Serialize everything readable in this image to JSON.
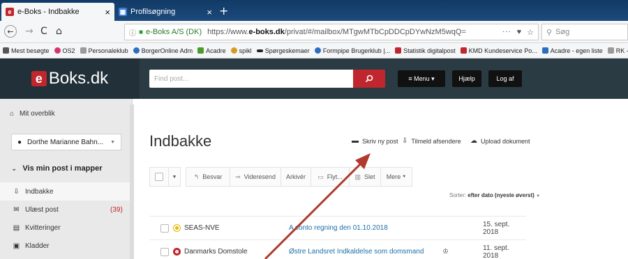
{
  "browser": {
    "tabs": [
      {
        "label": "e-Boks - Indbakke",
        "close": "×"
      },
      {
        "label": "Profilsøgning",
        "close": "×"
      }
    ],
    "new_tab": "+",
    "nav": {
      "back": "←",
      "forward": "→",
      "reload": "C",
      "home": "⌂"
    },
    "url": {
      "site": "e-Boks A/S (DK)",
      "prefix": "https://www.",
      "domain": "e-boks.dk",
      "path": "/privat/#/mailbox/MTgwMTbCpDDCpDYwNzM5wqQ=",
      "more": "···",
      "pocket": "♥",
      "star": "☆"
    },
    "search_placeholder": "Søg",
    "bookmarks": [
      {
        "label": "Mest besøgte",
        "color": "#555555"
      },
      {
        "label": "OS2",
        "color": "#d6336c"
      },
      {
        "label": "Personaleklub",
        "color": "#9a9a9a"
      },
      {
        "label": "BorgerOnline Adm",
        "color": "#2a6fbf"
      },
      {
        "label": "Acadre",
        "color": "#4c9a2a"
      },
      {
        "label": "spikl",
        "color": "#d89a1e"
      },
      {
        "label": "Spørgeskemaer",
        "color": "#222222"
      },
      {
        "label": "Formpipe Brugerklub |...",
        "color": "#2a6fbf"
      },
      {
        "label": "Statistik digitalpost",
        "color": "#c0262d"
      },
      {
        "label": "KMD Kundeservice Po...",
        "color": "#c0262d"
      },
      {
        "label": "Acadre - egen liste",
        "color": "#2a6fbf"
      },
      {
        "label": "RK - hjemmesi",
        "color": "#9a9a9a"
      }
    ]
  },
  "header": {
    "logo_e": "e",
    "logo_text": "Boks.dk",
    "find_placeholder": "Find post...",
    "menu_label": "≡ Menu ▾",
    "help_label": "Hjælp",
    "logout_label": "Log af"
  },
  "sidebar": {
    "overview": "Mit overblik",
    "user": "Dorthe Marianne Bahn...",
    "section": "Vis min post i mapper",
    "folders": [
      {
        "label": "Indbakke",
        "count": ""
      },
      {
        "label": "Ulæst post",
        "count": "(39)"
      },
      {
        "label": "Kvitteringer",
        "count": ""
      },
      {
        "label": "Kladder",
        "count": ""
      }
    ]
  },
  "main": {
    "title": "Indbakke",
    "actions": {
      "write": "Skriv ny post",
      "subscribe": "Tilmeld afsendere",
      "upload": "Upload dokument"
    },
    "toolbar": {
      "reply": "Besvar",
      "forward": "Videresend",
      "archive": "Arkivér",
      "flyt": "Flyt...",
      "delete": "Slet",
      "more": "Mere"
    },
    "sort": {
      "prefix": "Sorter:",
      "value": "efter dato (nyeste øverst)"
    },
    "messages": [
      {
        "sender": "SEAS-NVE",
        "subject": "A conto regning den 01.10.2018",
        "date": "15. sept. 2018",
        "icon_color": "#e5b800"
      },
      {
        "sender": "Danmarks Domstole",
        "subject": "Østre Landsret Indkaldelse som domsmand",
        "date": "11. sept. 2018",
        "icon_color": "#c0262d"
      }
    ]
  }
}
